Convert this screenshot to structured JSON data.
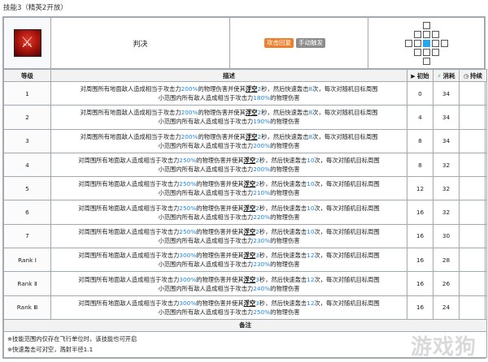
{
  "page_title": "技能3（精英2开放）",
  "skill": {
    "name": "判决",
    "icon_name": "skill-emblem-icon",
    "tags": [
      {
        "label": "攻击回复",
        "color": "#ee7f2d"
      },
      {
        "label": "手动触发",
        "color": "#8c8c8c"
      }
    ],
    "range_grid": [
      [
        0,
        0,
        1,
        0,
        0
      ],
      [
        0,
        1,
        1,
        1,
        0
      ],
      [
        1,
        1,
        2,
        1,
        1
      ],
      [
        0,
        1,
        1,
        1,
        0
      ],
      [
        0,
        0,
        1,
        0,
        0
      ]
    ]
  },
  "table": {
    "headers": {
      "level": "等级",
      "description": "描述",
      "initial": "初始",
      "cost": "消耗",
      "duration": "持续"
    },
    "desc_parts": {
      "p1": "对周围所有地面敌人造成相当于攻击力",
      "p2": "的物理伤害并使其",
      "float": "浮空",
      "p3": "秒，然后快速轰击",
      "p4": "次，每次对随机目标周围",
      "p5": "小范围内所有敌人造成相当于攻击力",
      "p6": "的物理伤害"
    },
    "rows": [
      {
        "level": "1",
        "atk1": "200%",
        "sec": "2",
        "hits": "8",
        "atk2": "180%",
        "init": "0",
        "cost": "34",
        "dur": ""
      },
      {
        "level": "2",
        "atk1": "200%",
        "sec": "2",
        "hits": "8",
        "atk2": "190%",
        "init": "4",
        "cost": "34",
        "dur": ""
      },
      {
        "level": "3",
        "atk1": "200%",
        "sec": "2",
        "hits": "8",
        "atk2": "200%",
        "init": "8",
        "cost": "34",
        "dur": ""
      },
      {
        "level": "4",
        "atk1": "250%",
        "sec": "2",
        "hits": "10",
        "atk2": "200%",
        "init": "8",
        "cost": "32",
        "dur": ""
      },
      {
        "level": "5",
        "atk1": "250%",
        "sec": "2",
        "hits": "10",
        "atk2": "210%",
        "init": "12",
        "cost": "32",
        "dur": ""
      },
      {
        "level": "6",
        "atk1": "250%",
        "sec": "2",
        "hits": "10",
        "atk2": "220%",
        "init": "16",
        "cost": "32",
        "dur": ""
      },
      {
        "level": "7",
        "atk1": "250%",
        "sec": "2",
        "hits": "10",
        "atk2": "230%",
        "init": "16",
        "cost": "30",
        "dur": ""
      },
      {
        "level": "Rank Ⅰ",
        "atk1": "300%",
        "sec": "3",
        "hits": "12",
        "atk2": "230%",
        "init": "16",
        "cost": "28",
        "dur": ""
      },
      {
        "level": "Rank Ⅱ",
        "atk1": "300%",
        "sec": "3",
        "hits": "12",
        "atk2": "240%",
        "init": "16",
        "cost": "26",
        "dur": ""
      },
      {
        "level": "Rank Ⅲ",
        "atk1": "300%",
        "sec": "3",
        "hits": "12",
        "atk2": "250%",
        "init": "16",
        "cost": "24",
        "dur": ""
      }
    ]
  },
  "notes": {
    "header": "备注",
    "lines": [
      "※技能范围内仅存在飞行单位时，该技能也可开启",
      "※快速轰击可对空，溅射半径1.1"
    ]
  },
  "watermark": "游戏狗"
}
